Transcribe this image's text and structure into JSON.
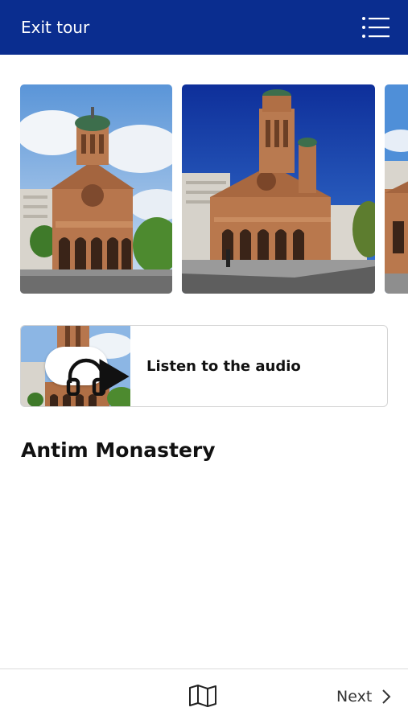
{
  "header": {
    "exit_label": "Exit tour",
    "menu_icon": "list-menu-icon",
    "background_color": "#0a2d8f"
  },
  "gallery": {
    "photos": [
      {
        "alt": "Antim Monastery church front view"
      },
      {
        "alt": "Antim Monastery church under blue sky"
      },
      {
        "alt": "Antim Monastery partial view"
      }
    ]
  },
  "audio": {
    "label": "Listen to the audio",
    "icons": [
      "headphones-icon",
      "play-icon"
    ]
  },
  "main": {
    "title": "Antim Monastery"
  },
  "bottom_bar": {
    "map_icon": "map-icon",
    "next_label": "Next",
    "next_icon": "chevron-right-icon"
  }
}
